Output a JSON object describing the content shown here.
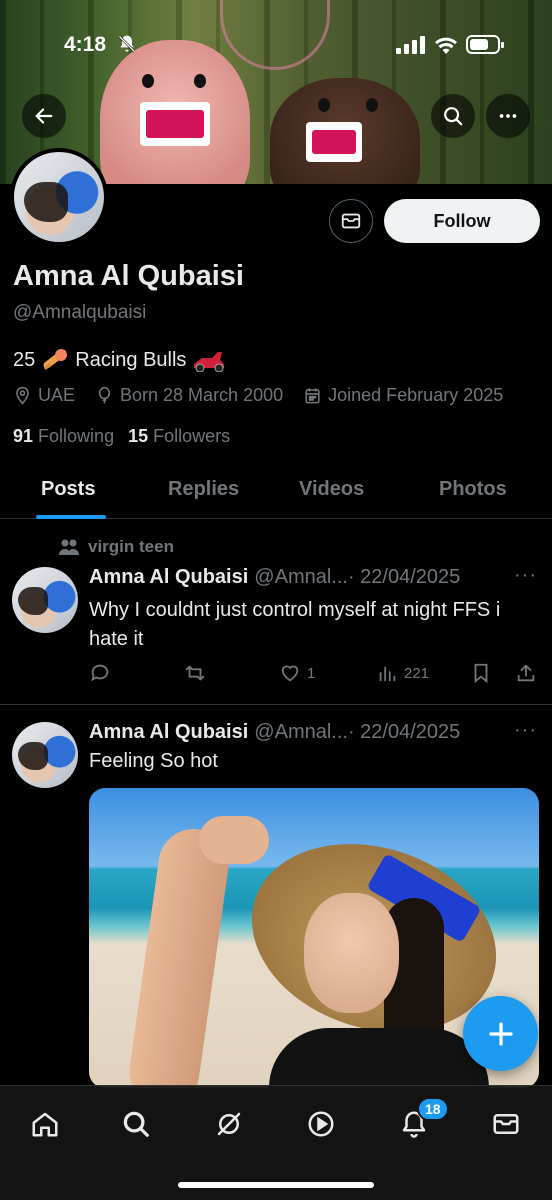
{
  "status_bar": {
    "time": "4:18"
  },
  "profile": {
    "name": "Amna Al Qubaisi",
    "handle": "@Amnalqubaisi",
    "bio_prefix": "25",
    "bio_text": "Racing Bulls",
    "location": "UAE",
    "born": "Born 28 March 2000",
    "joined": "Joined February 2025",
    "following_count": "91",
    "following_label": "Following",
    "followers_count": "15",
    "followers_label": "Followers",
    "follow_button": "Follow"
  },
  "tabs": [
    {
      "label": "Posts",
      "active": true
    },
    {
      "label": "Replies",
      "active": false
    },
    {
      "label": "Videos",
      "active": false
    },
    {
      "label": "Photos",
      "active": false
    }
  ],
  "posts": [
    {
      "context": "virgin teen",
      "author": "Amna Al Qubaisi",
      "handle": "@Amnal...",
      "date": "· 22/04/2025",
      "text": "Why I couldnt just control myself at night FFS i hate it",
      "likes": "1",
      "views": "221"
    },
    {
      "author": "Amna Al Qubaisi",
      "handle": "@Amnal...",
      "date": "· 22/04/2025",
      "text": "Feeling So hot"
    }
  ],
  "bottom_nav": {
    "notifications_badge": "18"
  },
  "colors": {
    "accent": "#1d9bf0",
    "background": "#000000",
    "secondary_text": "#71767b"
  }
}
